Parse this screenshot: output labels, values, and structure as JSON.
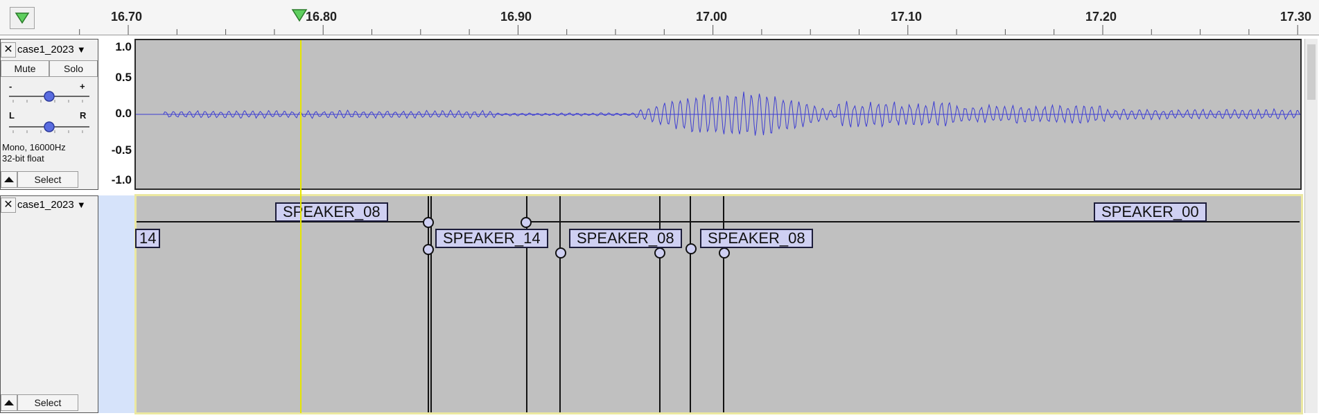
{
  "ruler": {
    "ticks": [
      "16.70",
      "16.80",
      "16.90",
      "17.00",
      "17.10",
      "17.20",
      "17.30"
    ]
  },
  "audio_track": {
    "name": "case1_2023",
    "mute_label": "Mute",
    "solo_label": "Solo",
    "gain_minus": "-",
    "gain_plus": "+",
    "pan_left": "L",
    "pan_right": "R",
    "info_line1": "Mono, 16000Hz",
    "info_line2": "32-bit float",
    "select_label": "Select",
    "y_labels": [
      "1.0",
      "0.5",
      "0.0",
      "-0.5",
      "-1.0"
    ],
    "waveform_color": "#3c3cd2"
  },
  "label_track": {
    "name": "case1_2023",
    "select_label": "Select",
    "labels": [
      "SPEAKER_08",
      "SPEAKER_00",
      "14",
      "SPEAKER_14",
      "SPEAKER_08",
      "SPEAKER_08"
    ]
  },
  "colors": {
    "track_bg": "#c0c0c0",
    "cursor": "#e6e600",
    "label_fill": "#cfd0f2",
    "selected_border": "#ebe8a0"
  }
}
